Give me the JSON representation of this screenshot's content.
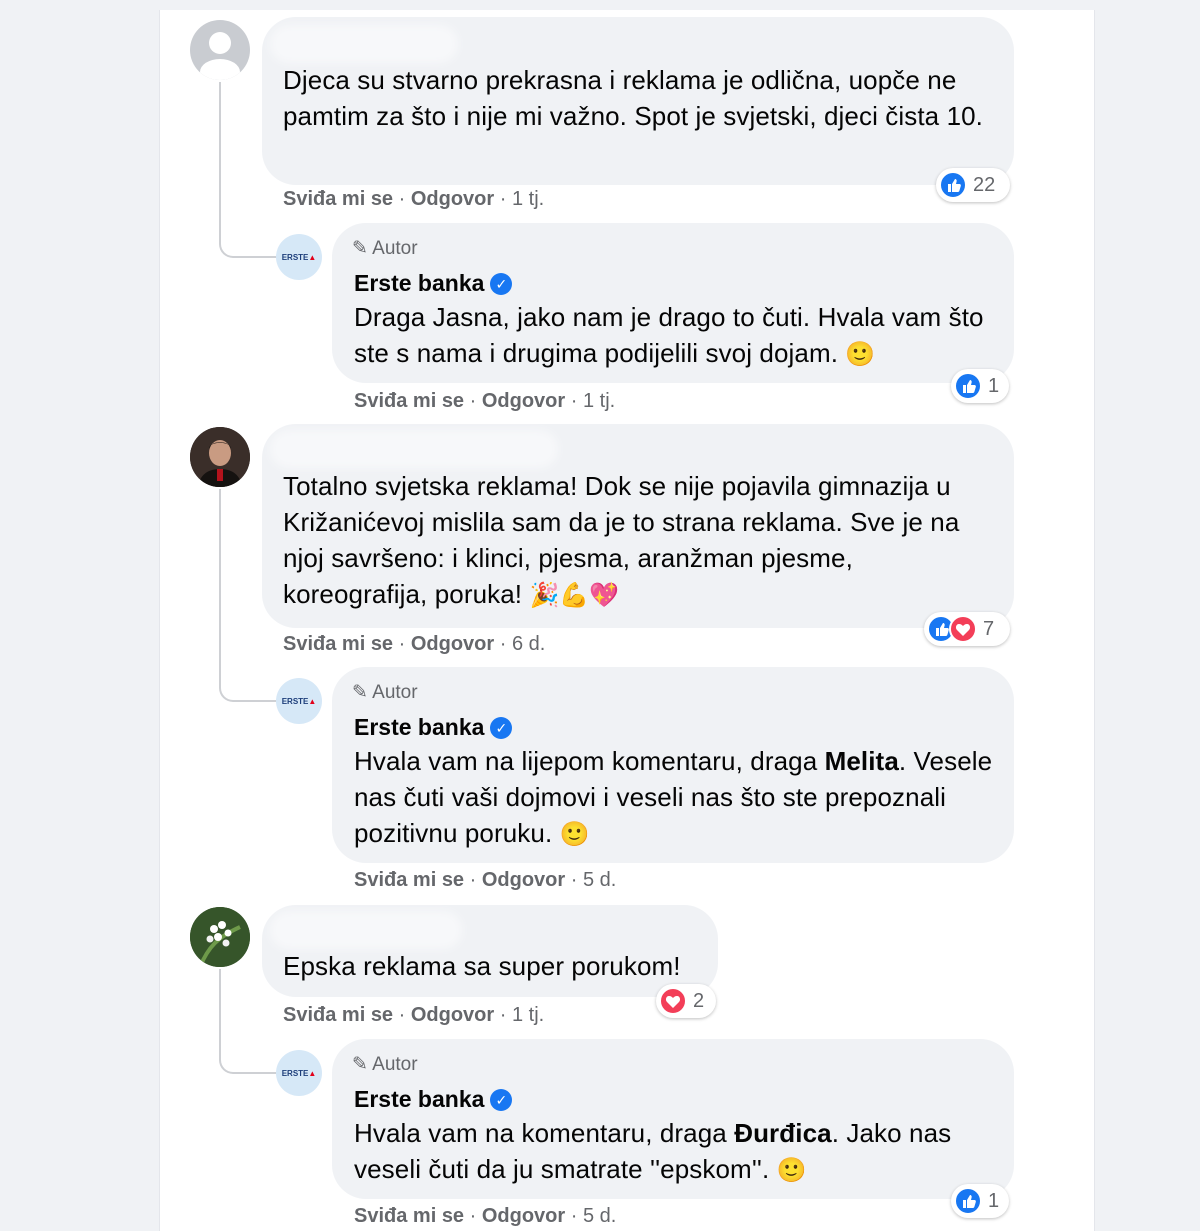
{
  "comments": [
    {
      "text": "Djeca su stvarno prekrasna i reklama je odlična, uopče ne pamtim za što i nije mi važno. Spot je svjetski, djeci čista 10.",
      "like_label": "Sviđa mi se",
      "reply_label": "Odgovor",
      "time": "1 tj.",
      "reaction_count": "22",
      "reply": {
        "badge": "Autor",
        "page_name": "Erste banka",
        "text": "Draga Jasna, jako nam je drago to čuti. Hvala vam što ste s nama i drugima podijelili svoj dojam.",
        "emoji": "🙂",
        "like_label": "Sviđa mi se",
        "reply_label": "Odgovor",
        "time": "1 tj.",
        "reaction_count": "1"
      }
    },
    {
      "text": "Totalno svjetska reklama! Dok se nije pojavila gimnazija u Križanićevoj mislila sam da je to strana reklama. Sve je na njoj savršeno: i klinci, pjesma, aranžman pjesme, koreografija, poruka!",
      "emoji": "🎉💪💖",
      "like_label": "Sviđa mi se",
      "reply_label": "Odgovor",
      "time": "6 d.",
      "reaction_count": "7",
      "reply": {
        "badge": "Autor",
        "page_name": "Erste banka",
        "text_before": "Hvala vam na lijepom komentaru, draga ",
        "text_bold": "Melita",
        "text_after": ". Vesele nas čuti vaši dojmovi i veseli nas što ste prepoznali pozitivnu poruku.",
        "emoji": "🙂",
        "like_label": "Sviđa mi se",
        "reply_label": "Odgovor",
        "time": "5 d."
      }
    },
    {
      "text": "Epska reklama sa super porukom!",
      "like_label": "Sviđa mi se",
      "reply_label": "Odgovor",
      "time": "1 tj.",
      "reaction_count": "2",
      "reply": {
        "badge": "Autor",
        "page_name": "Erste banka",
        "text_before": "Hvala vam na komentaru, draga ",
        "text_bold": "Đurđica",
        "text_after": ". Jako nas veseli čuti da ju smatrate ''epskom''.",
        "emoji": "🙂",
        "like_label": "Sviđa mi se",
        "reply_label": "Odgovor",
        "time": "5 d.",
        "reaction_count": "1"
      }
    }
  ],
  "logo_text": "ERSTE",
  "colors": {
    "like_blue": "#1877f2",
    "love_red": "#f33e58",
    "bubble_bg": "#f0f2f5",
    "meta_gray": "#65676b"
  },
  "icons": [
    "like-icon",
    "love-icon",
    "pencil-icon",
    "verified-icon"
  ]
}
